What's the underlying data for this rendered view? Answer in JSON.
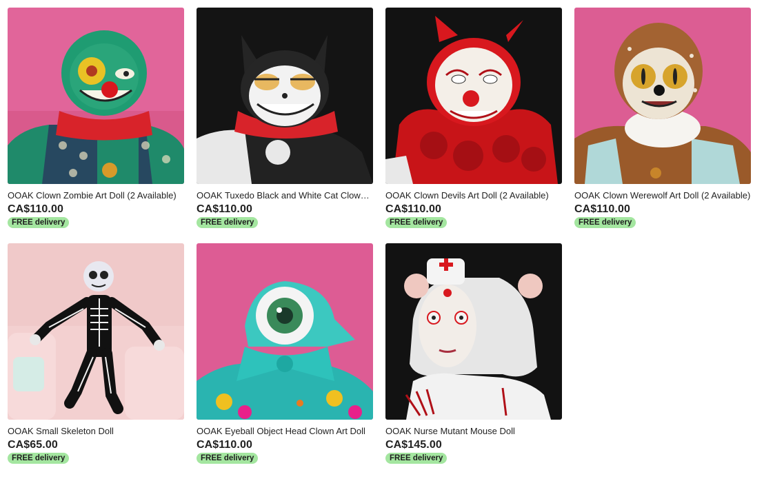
{
  "listings": [
    {
      "title": "OOAK Clown Zombie Art Doll (2 Available)",
      "price": "CA$110.00",
      "badge": "FREE delivery"
    },
    {
      "title": "OOAK Tuxedo Black and White Cat Clown Art Doll",
      "price": "CA$110.00",
      "badge": "FREE delivery"
    },
    {
      "title": "OOAK Clown Devils Art Doll (2 Available)",
      "price": "CA$110.00",
      "badge": "FREE delivery"
    },
    {
      "title": "OOAK Clown Werewolf Art Doll (2 Available)",
      "price": "CA$110.00",
      "badge": "FREE delivery"
    },
    {
      "title": "OOAK Small Skeleton Doll",
      "price": "CA$65.00",
      "badge": "FREE delivery"
    },
    {
      "title": "OOAK Eyeball Object Head Clown Art Doll",
      "price": "CA$110.00",
      "badge": "FREE delivery"
    },
    {
      "title": "OOAK Nurse Mutant Mouse Doll",
      "price": "CA$145.00",
      "badge": "FREE delivery"
    }
  ],
  "colors": {
    "badge_bg": "#a4e6a0",
    "text": "#222222"
  }
}
